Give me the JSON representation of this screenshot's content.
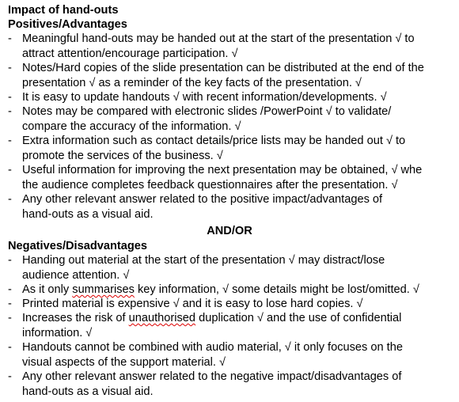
{
  "title": "Impact of hand-outs",
  "positives": {
    "heading": "Positives/Advantages",
    "items": [
      {
        "l1": "Meaningful hand-outs may be handed out at the start of the presentation √ to",
        "l2": "attract attention/encourage participation. √"
      },
      {
        "l1": "Notes/Hard copies of the slide presentation can be distributed at the end of the",
        "l2": "presentation √ as a reminder of the key facts of the presentation. √"
      },
      {
        "l1": "It is easy to update handouts √ with recent information/developments. √"
      },
      {
        "l1": "Notes may be compared with electronic slides /PowerPoint √ to validate/",
        "l2": "compare the accuracy of the information. √"
      },
      {
        "l1": "Extra information such as contact details/price lists may be handed out √ to",
        "l2": "promote the services of the business. √"
      },
      {
        "l1": "Useful information for improving the next presentation may be obtained, √ whe",
        "l2": "the audience completes feedback questionnaires after the presentation. √"
      },
      {
        "l1": "Any other relevant answer related to the positive impact/advantages of",
        "l2": "hand-outs as a visual aid."
      }
    ]
  },
  "separator": "AND/OR",
  "negatives": {
    "heading": "Negatives/Disadvantages",
    "items": [
      {
        "l1": "Handing out material at the start of the presentation √ may distract/lose",
        "l2": "audience attention. √"
      },
      {
        "l1a": "As it only ",
        "l1w": "summarises",
        "l1b": " key information, √ some details might be lost/omitted. √"
      },
      {
        "l1": "Printed material is expensive √ and it is easy to lose hard copies. √"
      },
      {
        "l1a": "Increases the risk of ",
        "l1w": "unauthorised",
        "l1b": " duplication √ and the use of confidential",
        "l2": "information. √"
      },
      {
        "l1": "Handouts cannot be combined with audio material, √ it only focuses on the",
        "l2": "visual aspects of the support material. √"
      },
      {
        "l1": "Any other relevant answer related to the negative impact/disadvantages of",
        "l2": "hand-outs as a visual aid."
      }
    ]
  },
  "dash": "-"
}
